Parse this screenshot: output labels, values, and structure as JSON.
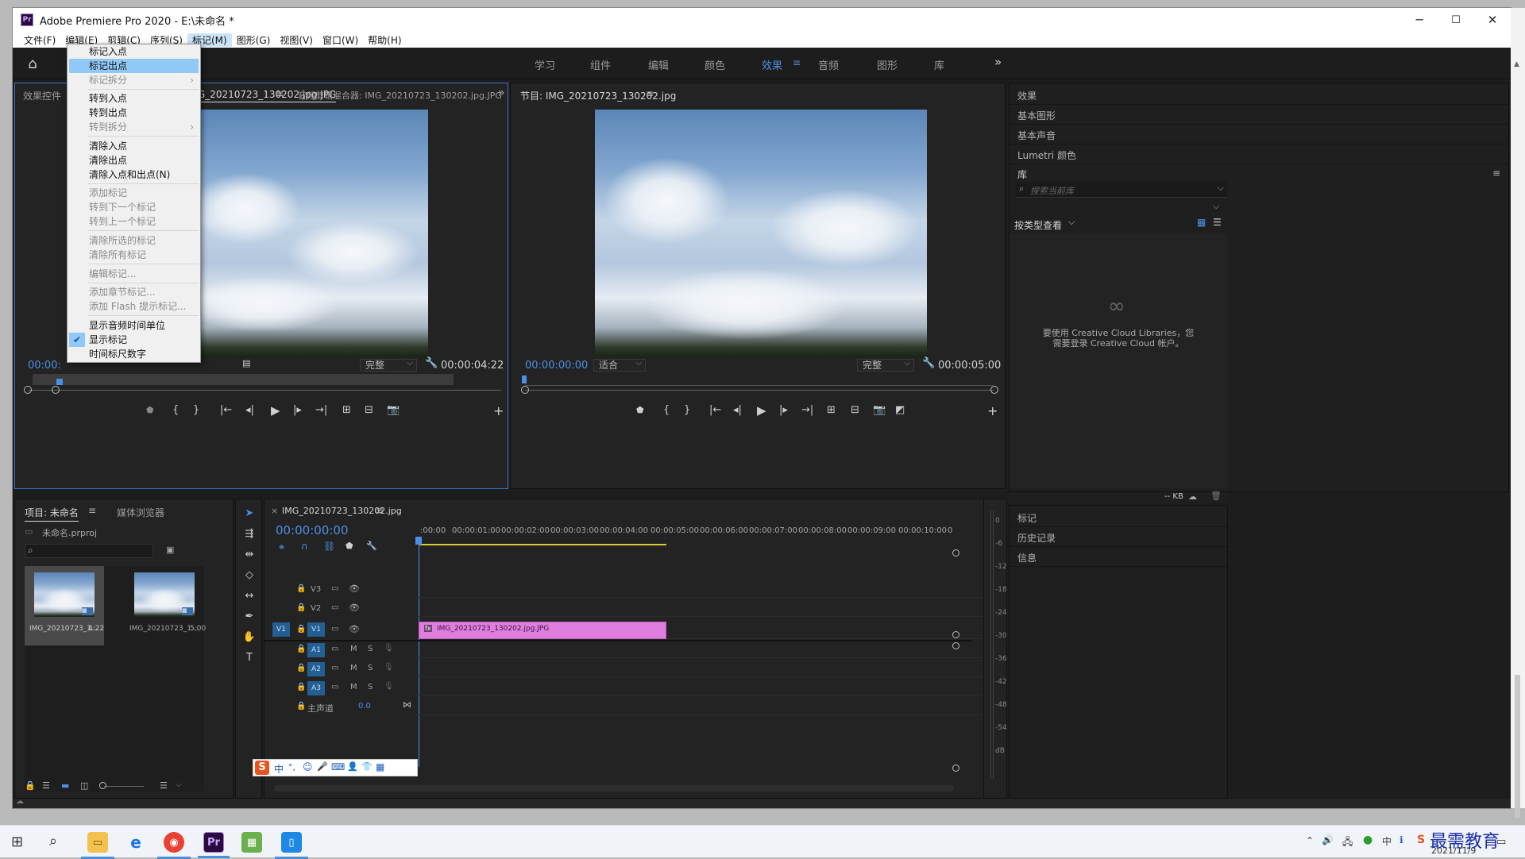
{
  "app": {
    "title": "Adobe Premiere Pro 2020 - E:\\未命名 *",
    "logo": "Pr",
    "minimize": "─",
    "maximize": "☐",
    "close": "✕"
  },
  "menu": [
    "文件(F)",
    "编辑(E)",
    "剪辑(C)",
    "序列(S)",
    "标记(M)",
    "图形(G)",
    "视图(V)",
    "窗口(W)",
    "帮助(H)"
  ],
  "workspaces": {
    "items": [
      "学习",
      "组件",
      "编辑",
      "颜色",
      "效果",
      "音频",
      "图形",
      "库"
    ],
    "active": "效果",
    "more": "»"
  },
  "source_panel": {
    "tabs": [
      "效果控件",
      "IMG_20210723_130202.jpg.JPG",
      "音频剪辑混合器: IMG_20210723_130202.jpg.JPG"
    ],
    "timecode_left": "00:00:",
    "fit": "完整",
    "timecode_right": "00:00:04:22",
    "more": "»"
  },
  "program_panel": {
    "tab": "节目: IMG_20210723_130202.jpg",
    "timecode_left": "00:00:00:00",
    "zoom": "适合",
    "quality": "完整",
    "timecode_right": "00:00:05:00"
  },
  "marker_menu": {
    "items": [
      {
        "label": "标记入点",
        "state": "normal"
      },
      {
        "label": "标记出点",
        "state": "highlight"
      },
      {
        "label": "标记拆分",
        "state": "disabled",
        "submenu": true
      },
      {
        "label": "转到入点",
        "state": "normal"
      },
      {
        "label": "转到出点",
        "state": "normal"
      },
      {
        "label": "转到拆分",
        "state": "disabled",
        "submenu": true
      },
      {
        "label": "清除入点",
        "state": "normal"
      },
      {
        "label": "清除出点",
        "state": "normal"
      },
      {
        "label": "清除入点和出点(N)",
        "state": "normal"
      },
      {
        "label": "添加标记",
        "state": "disabled"
      },
      {
        "label": "转到下一个标记",
        "state": "disabled"
      },
      {
        "label": "转到上一个标记",
        "state": "disabled"
      },
      {
        "label": "清除所选的标记",
        "state": "disabled"
      },
      {
        "label": "清除所有标记",
        "state": "disabled"
      },
      {
        "label": "编辑标记...",
        "state": "disabled"
      },
      {
        "label": "添加章节标记...",
        "state": "disabled"
      },
      {
        "label": "添加 Flash 提示标记...",
        "state": "disabled"
      },
      {
        "label": "显示音频时间单位",
        "state": "normal"
      },
      {
        "label": "显示标记",
        "state": "checked"
      },
      {
        "label": "时间标尺数字",
        "state": "normal"
      }
    ]
  },
  "right_panel": {
    "items": [
      "效果",
      "基本图形",
      "基本声音",
      "Lumetri 颜色"
    ],
    "library_title": "库",
    "search_placeholder": "搜索当前库",
    "view_by": "按类型查看",
    "empty_msg_1": "要使用 Creative Cloud Libraries，您",
    "empty_msg_2": "需要登录 Creative Cloud 帐户。",
    "kb": "-- KB",
    "bottom_items": [
      "标记",
      "历史记录",
      "信息"
    ]
  },
  "project_panel": {
    "tabs": [
      "项目: 未命名",
      "媒体浏览器"
    ],
    "file": "未命名.prproj",
    "items": [
      {
        "name": "IMG_20210723_1...",
        "dur": "4:22"
      },
      {
        "name": "IMG_20210723_1...",
        "dur": "5:00"
      }
    ]
  },
  "timeline": {
    "tab": "IMG_20210723_130202.jpg",
    "close": "×",
    "timecode": "00:00:00:00",
    "ticks": [
      ":00:00",
      "00:00:01:00",
      "00:00:02:00",
      "00:00:03:00",
      "00:00:04:00",
      "00:00:05:00",
      "00:00:06:00",
      "00:00:07:00",
      "00:00:08:00",
      "00:00:09:00",
      "00:00:10:00",
      "0"
    ],
    "video_tracks": [
      "V3",
      "V2",
      "V1"
    ],
    "audio_tracks": [
      "A1",
      "A2",
      "A3"
    ],
    "master": "主声道",
    "master_val": "0.0",
    "clip_name": "IMG_20210723_130202.jpg.JPG",
    "source_patch": "V1",
    "m": "M",
    "s": "S",
    "meter": [
      "0",
      "-6",
      "-12",
      "-18",
      "-24",
      "-30",
      "-36",
      "-42",
      "-48",
      "-54",
      "dB"
    ]
  },
  "ime": {
    "items": [
      "中",
      "°,",
      "☺",
      "🎤",
      "⌨",
      "👤",
      "👕",
      "▦"
    ]
  },
  "taskbar": {
    "date": "2021/11/9",
    "pr": "Pr",
    "watermark": "最需教育"
  },
  "colors": {
    "accent": "#4c8fe6",
    "clip": "#e07ee0",
    "menu_hl": "#90c8f6"
  }
}
